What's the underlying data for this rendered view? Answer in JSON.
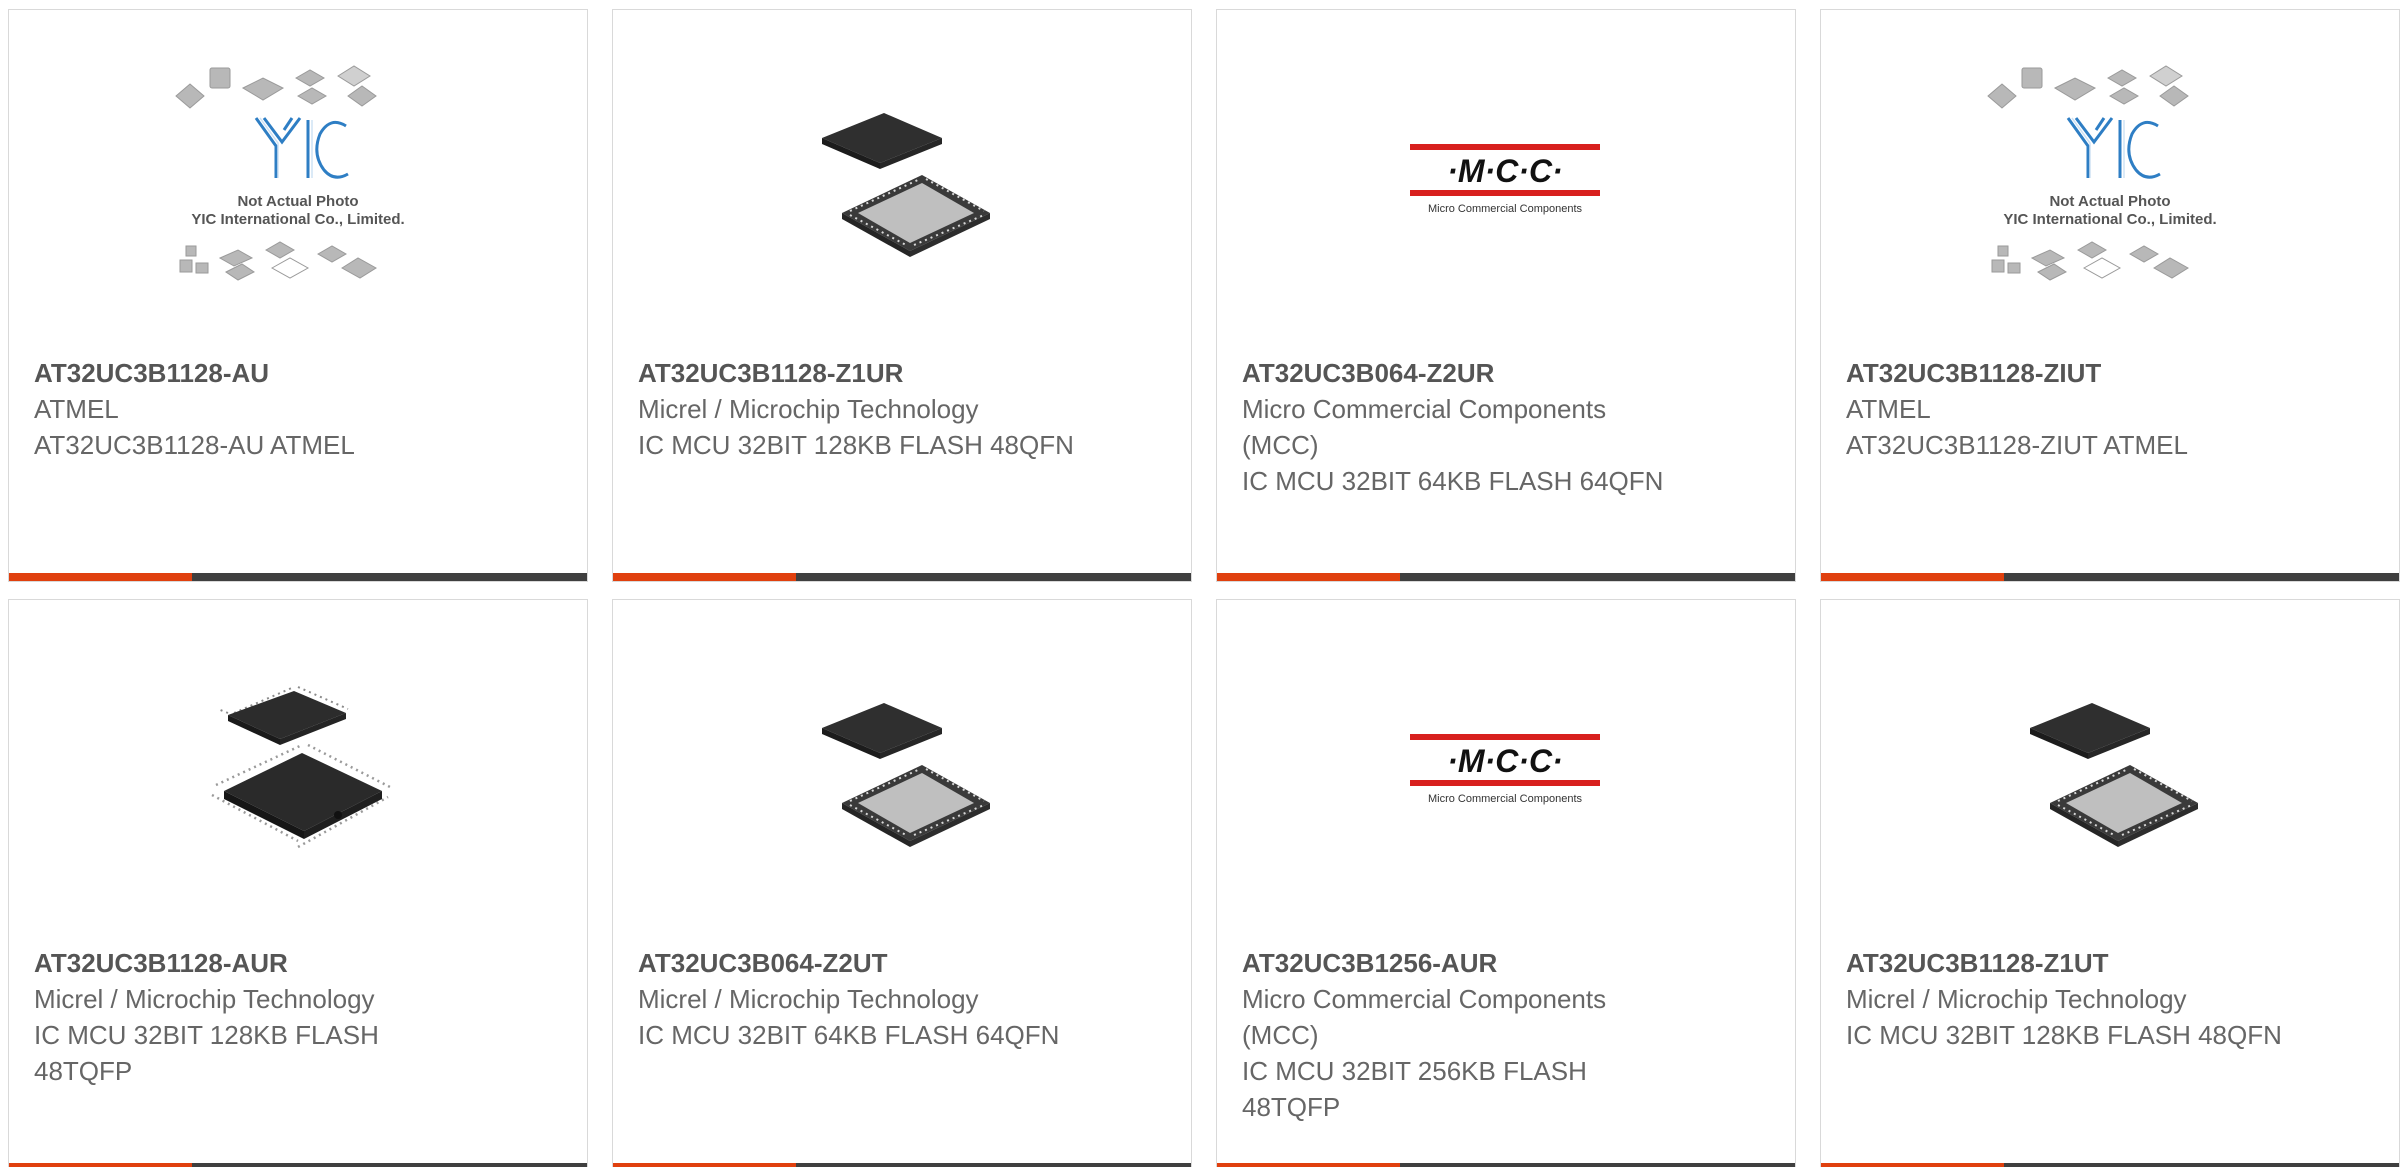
{
  "colors": {
    "accent": "#e0400e",
    "bar": "#3f3f3f",
    "title": "#555555",
    "text": "#666666",
    "mcc_red": "#d8201e"
  },
  "products": [
    {
      "part_number": "AT32UC3B1128-AU",
      "manufacturer": "ATMEL",
      "description": "AT32UC3B1128-AU ATMEL",
      "image": "yic-placeholder-image",
      "image_text": [
        "Not Actual Photo",
        "YIC International Co., Limited."
      ]
    },
    {
      "part_number": "AT32UC3B1128-Z1UR",
      "manufacturer": "Micrel / Microchip Technology",
      "description": "IC MCU 32BIT 128KB FLASH 48QFN",
      "image": "qfn-chip-image"
    },
    {
      "part_number": "AT32UC3B064-Z2UR",
      "manufacturer": "Micro Commercial Components (MCC)",
      "description": "IC MCU 32BIT 64KB FLASH 64QFN",
      "image": "mcc-logo-image",
      "logo_text": "·M·C·C·",
      "logo_sub": "Micro Commercial Components"
    },
    {
      "part_number": "AT32UC3B1128-ZIUT",
      "manufacturer": "ATMEL",
      "description": "AT32UC3B1128-ZIUT ATMEL",
      "image": "yic-placeholder-image",
      "image_text": [
        "Not Actual Photo",
        "YIC International Co., Limited."
      ]
    },
    {
      "part_number": "AT32UC3B1128-AUR",
      "manufacturer": "Micrel / Microchip Technology",
      "description": "IC MCU 32BIT 128KB FLASH 48TQFP",
      "image": "tqfp-chip-image"
    },
    {
      "part_number": "AT32UC3B064-Z2UT",
      "manufacturer": "Micrel / Microchip Technology",
      "description": "IC MCU 32BIT 64KB FLASH 64QFN",
      "image": "qfn-chip-image"
    },
    {
      "part_number": "AT32UC3B1256-AUR",
      "manufacturer": "Micro Commercial Components (MCC)",
      "description": "IC MCU 32BIT 256KB FLASH 48TQFP",
      "image": "mcc-logo-image",
      "logo_text": "·M·C·C·",
      "logo_sub": "Micro Commercial Components"
    },
    {
      "part_number": "AT32UC3B1128-Z1UT",
      "manufacturer": "Micrel / Microchip Technology",
      "description": "IC MCU 32BIT 128KB FLASH 48QFN",
      "image": "qfn-chip-image"
    }
  ]
}
